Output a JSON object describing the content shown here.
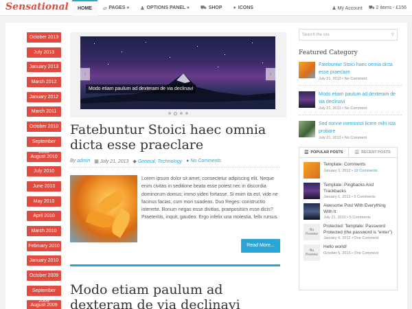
{
  "logo": "Sensational",
  "nav": [
    {
      "label": "HOME",
      "icon": "",
      "active": true
    },
    {
      "label": "PAGES »",
      "icon": "pages-icon"
    },
    {
      "label": "OPTIONS PANEL »",
      "icon": "user-icon"
    },
    {
      "label": "SHOP",
      "icon": "cart-icon"
    },
    {
      "label": "ICONS",
      "icon": "apple-icon"
    }
  ],
  "account": {
    "my_account": "My Account",
    "cart": "2 items - £156"
  },
  "archive": [
    "October 2013",
    "July 2013",
    "January 2013",
    "March 2012",
    "January 2012",
    "March 2011",
    "October 2010",
    "September 2010",
    "August 2010",
    "July 2010",
    "June 2010",
    "May 2010",
    "April 2010",
    "March 2010",
    "February 2010",
    "January 2010",
    "October 2009",
    "September 2009",
    "August 2009"
  ],
  "slider": {
    "caption": "Modo etiam paulum ad dexteram de via declinavi"
  },
  "post1": {
    "title": "Fatebuntur Stoici haec omnia dicta esse praeclare",
    "by": "By",
    "author": "admin",
    "date": "July 21, 2013",
    "cats": "General, Technology",
    "comments": "No Comments",
    "excerpt": "Lorem ipsum dolor sit amet, consectetur adipiscing elit. Neque enim civitas in seditione beata esse potest nec in discordia dominorum domus; immo videri fortasse. Si enim ita est, vide ne facinus facias, cum mori suadeas. Duo Reges: constructio interrete. Bonum negas esse divitias, praepositüm esse dicis? Praeteritis, inquit, gaudeo. Ergo infelix una molestia, fellx rursus.",
    "read_more": "Read More..."
  },
  "post2": {
    "title": "Modo etiam paulum ad dexteram de via declinavi"
  },
  "sidebar": {
    "search_placeholder": "Search the site",
    "featured_title": "Featured Category",
    "featured": [
      {
        "title": "Fatebuntur Stoici haec omnia dicta esse praeclare",
        "date": "July 21, 2013 • No Comment"
      },
      {
        "title": "Modo etiam paulum ad dexteram de via declinavi",
        "date": "July 21, 2013 • No Comment"
      },
      {
        "title": "Sed nonne merninisti licere mihi ista probare",
        "date": "July 21, 2013 • No Comment"
      }
    ],
    "tab_popular": "POPULAR POSTS",
    "tab_recent": "RECENT POSTS",
    "popular": [
      {
        "title": "Template: Comments",
        "date": "January 3, 2012 • ",
        "count": "19 Comments",
        "img": "thumb"
      },
      {
        "title": "Template: Pingbacks And Trackbacks",
        "date": "January 1, 2013 • 5 Comments",
        "count": "",
        "img": "thumb"
      },
      {
        "title": "Awesome Post With Everything With It",
        "date": "July 21, 2013 • 5 Comments",
        "count": "",
        "img": "thumb"
      },
      {
        "title": "Protected: Template: Password Protected (the password is “enter”)",
        "date": "January 4, 2012 • One Comment",
        "count": "",
        "img": "No Preview"
      },
      {
        "title": "Hello world!",
        "date": "October 5, 2013 • One Comment",
        "count": "",
        "img": "No Preview"
      }
    ]
  }
}
